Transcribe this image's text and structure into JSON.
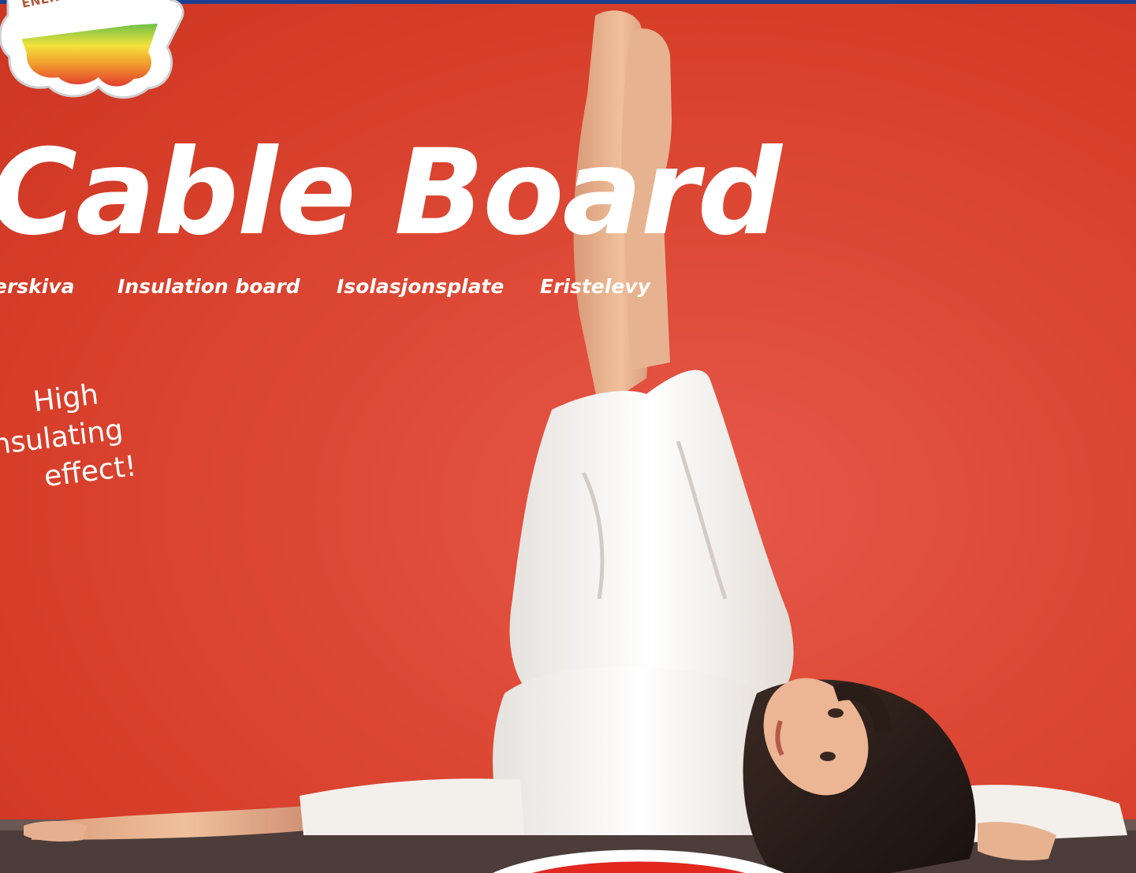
{
  "logo": {
    "text": "ENERGY SAVER",
    "reg_mark": "®"
  },
  "title": "Cable Board",
  "subtitles": [
    "erskiva",
    "Insulation board",
    "Isolasjonsplate",
    "Eristelevy"
  ],
  "tagline": [
    "High",
    "nsulating",
    "effect!"
  ],
  "colors": {
    "background": "#d9402b",
    "top_bar": "#1d3f8f",
    "text": "#ffffff"
  },
  "photo": "woman in white clothing lying on floor with legs raised against red wall"
}
